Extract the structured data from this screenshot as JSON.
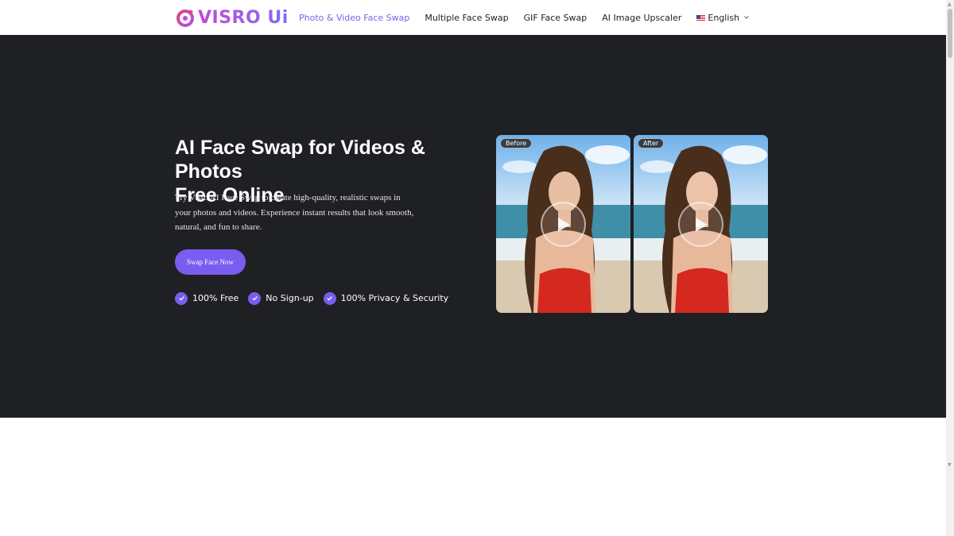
{
  "header": {
    "logo_text": "VISRO Ui",
    "nav": [
      {
        "label": "Photo & Video Face Swap",
        "active": true
      },
      {
        "label": "Multiple Face Swap",
        "active": false
      },
      {
        "label": "GIF Face Swap",
        "active": false
      },
      {
        "label": "AI Image Upscaler",
        "active": false
      }
    ],
    "language": "English"
  },
  "hero": {
    "title_line1": "AI Face Swap for Videos & Photos",
    "title_line2": "Free Online",
    "description": "Try Visro AI Face Swap to create high-quality, realistic swaps in your photos and videos. Experience instant results that look smooth, natural, and fun to share.",
    "cta_label": "Swap Face Now",
    "features": [
      "100% Free",
      "No Sign-up",
      "100% Privacy & Security"
    ],
    "before_label": "Before",
    "after_label": "After"
  },
  "colors": {
    "accent": "#7b5cf0",
    "hero_bg": "#1f2023",
    "nav_active": "#7a62e6"
  },
  "icons": [
    "logo-icon",
    "us-flag-icon",
    "chevron-down-icon",
    "check-icon",
    "play-icon"
  ]
}
